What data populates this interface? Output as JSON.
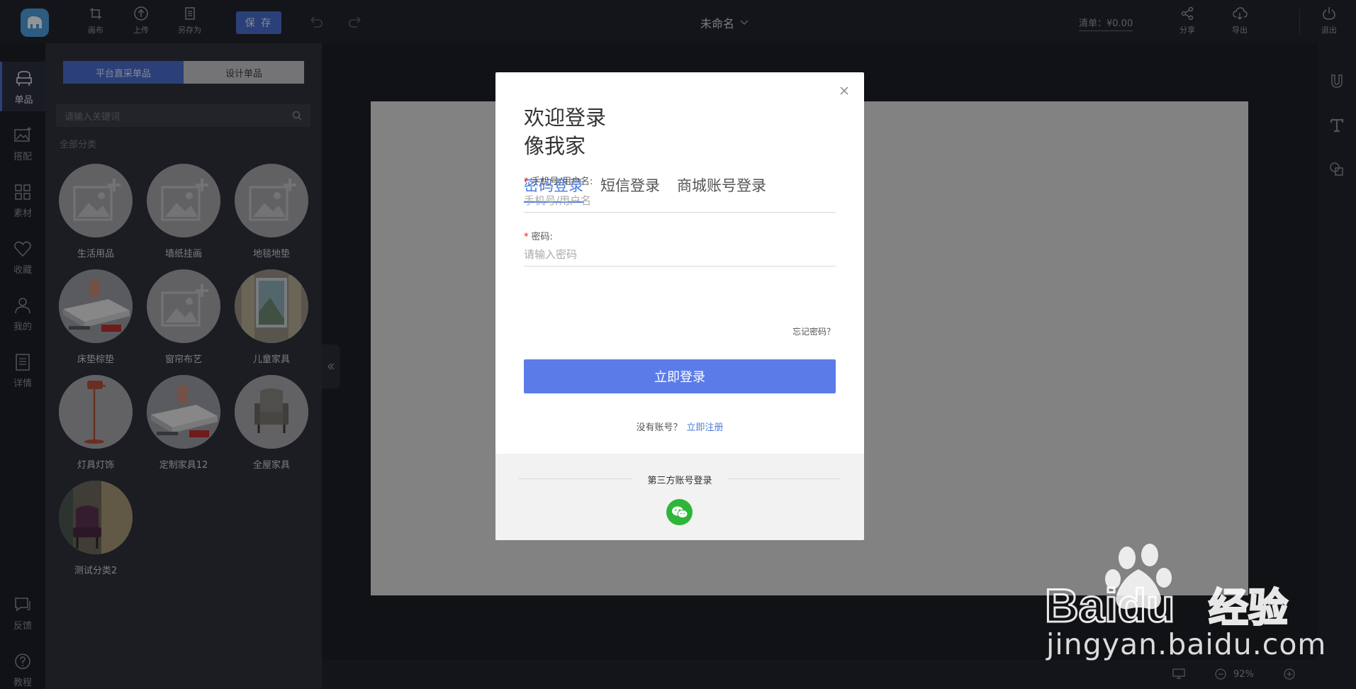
{
  "topbar": {
    "buttons": [
      {
        "label": "画布",
        "icon": "canvas-icon"
      },
      {
        "label": "上传",
        "icon": "upload-icon"
      },
      {
        "label": "另存为",
        "icon": "save-as-icon"
      }
    ],
    "save_label": "保 存",
    "doc_title": "未命名",
    "cart_label": "清单：¥0.00",
    "share_label": "分享",
    "export_label": "导出",
    "logout_label": "退出"
  },
  "leftnav": [
    {
      "label": "单品",
      "icon": "sofa-icon",
      "active": true
    },
    {
      "label": "搭配",
      "icon": "image-add-icon",
      "active": false
    },
    {
      "label": "素材",
      "icon": "grid-icon",
      "active": false
    },
    {
      "label": "收藏",
      "icon": "heart-icon",
      "active": false
    },
    {
      "label": "我的",
      "icon": "user-icon",
      "active": false
    },
    {
      "label": "详情",
      "icon": "document-icon",
      "active": false
    },
    {
      "label": "反馈",
      "icon": "chat-icon",
      "active": false
    },
    {
      "label": "教程",
      "icon": "help-icon",
      "active": false
    }
  ],
  "panel": {
    "tabs": [
      "平台直采单品",
      "设计单品"
    ],
    "search_placeholder": "请输入关键词",
    "all_categories": "全部分类",
    "categories": [
      {
        "label": "生活用品",
        "thumb": "placeholder"
      },
      {
        "label": "墙纸挂画",
        "thumb": "placeholder"
      },
      {
        "label": "地毯地垫",
        "thumb": "placeholder"
      },
      {
        "label": "床垫棕垫",
        "thumb": "mattress"
      },
      {
        "label": "窗帘布艺",
        "thumb": "placeholder"
      },
      {
        "label": "儿童家具",
        "thumb": "room"
      },
      {
        "label": "灯具灯饰",
        "thumb": "lamp"
      },
      {
        "label": "定制家具12",
        "thumb": "mattress"
      },
      {
        "label": "全屋家具",
        "thumb": "chair"
      },
      {
        "label": "测试分类2",
        "thumb": "chair-dark"
      }
    ]
  },
  "bottombar": {
    "zoom": "92%"
  },
  "dialog": {
    "title_line1": "欢迎登录",
    "title_line2": "像我家",
    "tabs": [
      "密码登录",
      "短信登录",
      "商城账号登录"
    ],
    "username_label": "手机号/用户名:",
    "username_placeholder": "手机号/用户名",
    "password_label": "密码:",
    "password_placeholder": "请输入密码",
    "forgot": "忘记密码？",
    "login_button": "立即登录",
    "no_account": "没有账号？",
    "register_link": "立即注册",
    "third_party_label": "第三方账号登录"
  },
  "watermark": {
    "text": "jingyan.baidu.com",
    "brand": "Baidu",
    "brand_cn": "经验"
  },
  "colors": {
    "accent": "#4a6fd0",
    "login_button": "#5b7ce8",
    "wechat": "#2fb53a"
  }
}
